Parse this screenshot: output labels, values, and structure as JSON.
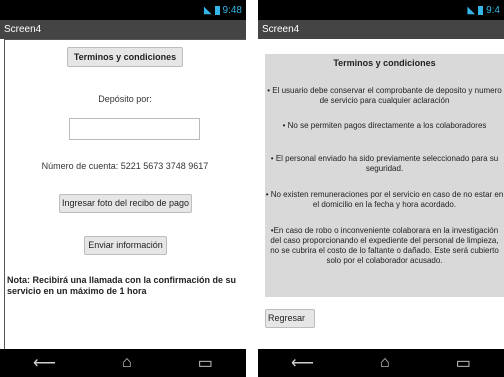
{
  "left": {
    "status": {
      "time": "9:48"
    },
    "title": "Screen4",
    "terms_button": "Terminos y condiciones",
    "deposit_label": "Depósito por:",
    "deposit_value": "",
    "account_number": "Número de cuenta: 5221 5673 3748 9617",
    "upload_button": "Ingresar foto del recibo de pago",
    "send_button": "Enviar información",
    "note": "Nota: Recibirá una llamada con la confirmación de su servicio en un máximo de 1 hora"
  },
  "right": {
    "status": {
      "time": "9:4"
    },
    "title": "Screen4",
    "heading": "Terminos y condiciones",
    "items": [
      "• El usuario debe conservar el comprobante de deposito y numero de servicio para cualquier aclaración",
      "• No se permiten pagos directamente a los colaboradores",
      "• El personal enviado ha sido previamente seleccionado para su seguridad.",
      "• No existen remuneraciones por el servicio en caso de no estar en el domicilio en la fecha y hora acordado.",
      "•En caso de robo o inconveniente colaborara en la investigación del caso proporcionando el expediente del personal de limpieza, no se cubrira el costo de lo faltante o dañado. Este será cubierto solo por el colaborador acusado."
    ],
    "back_button": "Regresar"
  },
  "nav": {
    "back": "⟵",
    "home": "⌂",
    "recent": "▭"
  }
}
